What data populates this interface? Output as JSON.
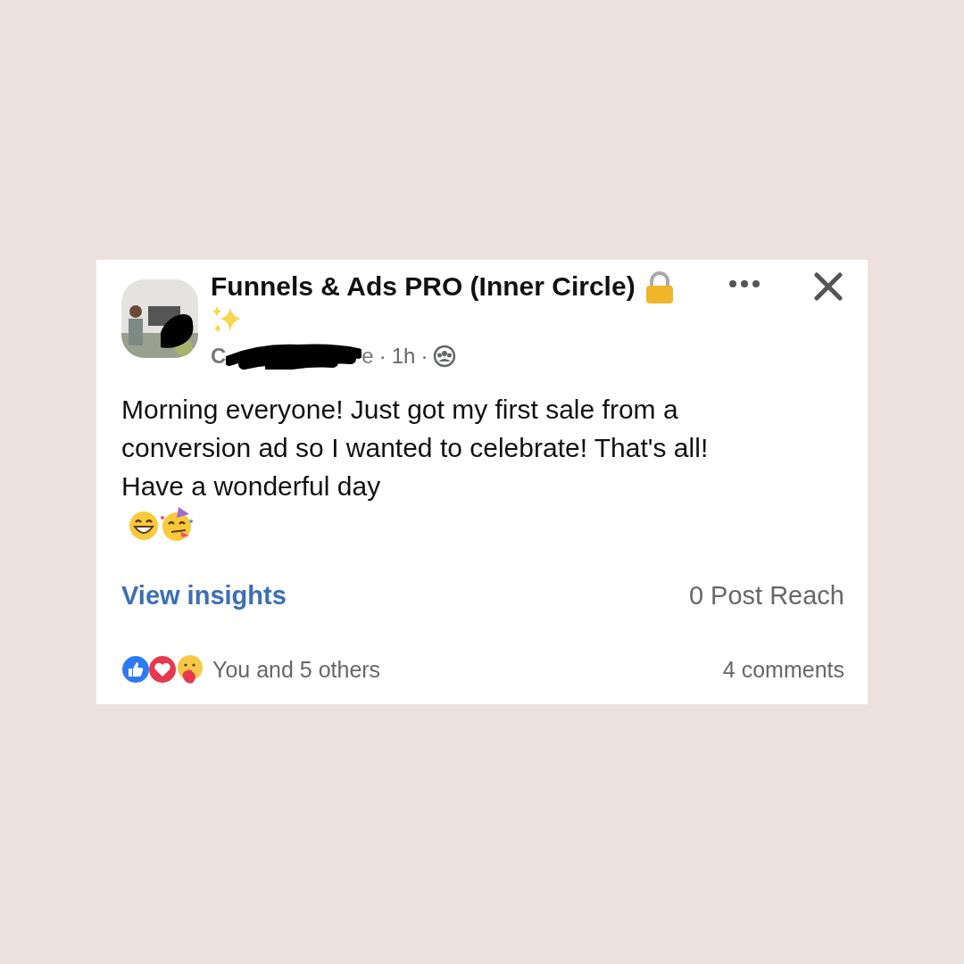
{
  "post": {
    "group_title": "Funnels & Ads PRO (Inner Circle)",
    "author_start": "C",
    "author_end": "e",
    "separator": "·",
    "time": "1h",
    "body": "Morning everyone! Just got my first sale from a conversion ad so I wanted to celebrate! That's all! Have a wonderful day",
    "insights_link": "View insights",
    "reach": "0 Post Reach",
    "reactions_text": "You and 5 others",
    "comments": "4 comments"
  }
}
